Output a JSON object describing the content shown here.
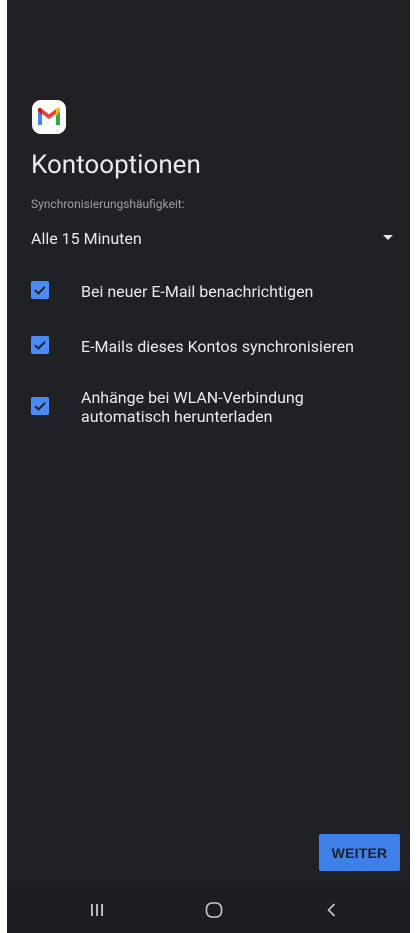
{
  "screen": {
    "title": "Kontooptionen",
    "logo_icon": "gmail-logo-icon"
  },
  "sync": {
    "label": "Synchronisierungshäufigkeit:",
    "selected_value": "Alle 15 Minuten",
    "arrow_icon": "dropdown-arrow-icon"
  },
  "options": [
    {
      "label_line1": "Bei neuer E-Mail benachrichtigen",
      "label_line2": "",
      "checked": true
    },
    {
      "label_line1": "E-Mails dieses Kontos synchronisieren",
      "label_line2": "",
      "checked": true
    },
    {
      "label_line1": "Anhänge bei WLAN-Verbindung",
      "label_line2": "automatisch herunterladen",
      "checked": true
    }
  ],
  "actions": {
    "next_label": "WEITER"
  },
  "nav": {
    "recents_icon": "recent-apps-icon",
    "home_icon": "home-icon",
    "back_icon": "back-icon"
  },
  "colors": {
    "background": "#202125",
    "accent": "#4b8bf5",
    "text": "#e8eaed",
    "secondary_text": "#9aa0a6"
  }
}
